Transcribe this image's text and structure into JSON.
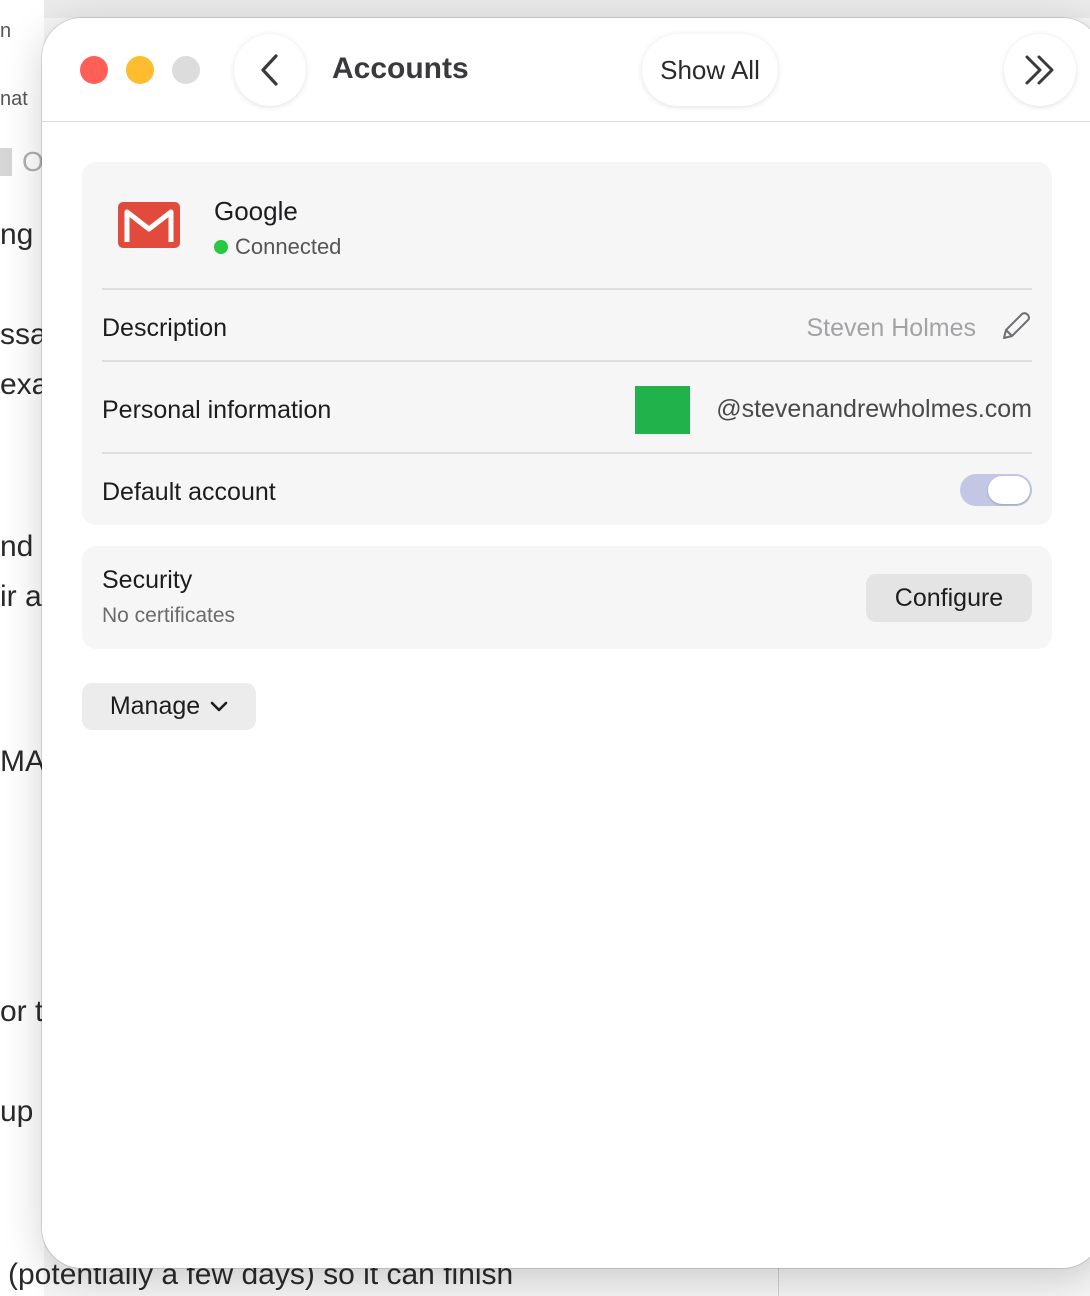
{
  "background": {
    "fragments": [
      "n",
      "nat",
      "ng",
      "ssag",
      "exar",
      "nd",
      "ir a",
      "MA",
      "or t",
      "up"
    ],
    "chip_letter": "O",
    "bottom_line": "(potentially a few days) so it can finish"
  },
  "window": {
    "title": "Accounts",
    "show_all_label": "Show All"
  },
  "account": {
    "provider": "Google",
    "status": "Connected",
    "rows": {
      "description_label": "Description",
      "description_value": "Steven Holmes",
      "personal_info_label": "Personal information",
      "email_suffix": "@stevenandrewholmes.com",
      "default_label": "Default account",
      "default_on": true
    }
  },
  "security": {
    "title": "Security",
    "subtitle": "No certificates",
    "configure_label": "Configure"
  },
  "manage_label": "Manage",
  "colors": {
    "connected": "#28c840",
    "redaction": "#21b24b",
    "gmail_red": "#e24b3b",
    "toggle_track": "#c2c7e6"
  }
}
